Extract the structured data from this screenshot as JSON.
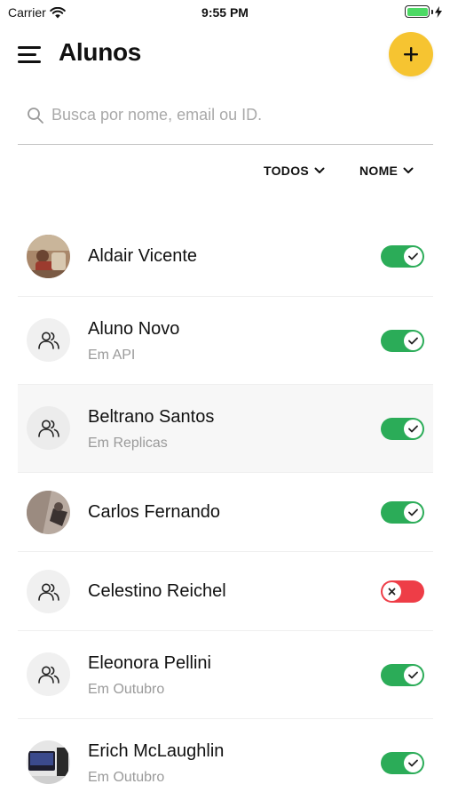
{
  "status_bar": {
    "carrier": "Carrier",
    "time": "9:55 PM",
    "wifi_icon": "wifi-icon",
    "battery_icon": "battery-icon",
    "charging_icon": "bolt-icon"
  },
  "header": {
    "title": "Alunos",
    "menu_icon": "hamburger-menu-icon",
    "add_icon": "plus-icon",
    "accent_color": "#f6c431"
  },
  "search": {
    "value": "",
    "placeholder": "Busca por nome, email ou ID.",
    "icon": "search-icon"
  },
  "filters": {
    "status": {
      "label": "TODOS",
      "icon": "chevron-down-icon"
    },
    "sort": {
      "label": "NOME",
      "icon": "chevron-down-icon"
    }
  },
  "colors": {
    "active": "#2bac58",
    "inactive": "#ee3d47",
    "subtitle": "#9a9a9a"
  },
  "students": [
    {
      "name": "Aldair Vicente",
      "subtitle": "",
      "avatar": "photo",
      "active": true,
      "highlighted": false
    },
    {
      "name": "Aluno Novo",
      "subtitle": "Em API",
      "avatar": "group-icon",
      "active": true,
      "highlighted": false
    },
    {
      "name": "Beltrano Santos",
      "subtitle": "Em Replicas",
      "avatar": "group-icon",
      "active": true,
      "highlighted": true
    },
    {
      "name": "Carlos Fernando",
      "subtitle": "",
      "avatar": "photo",
      "active": true,
      "highlighted": false
    },
    {
      "name": "Celestino Reichel",
      "subtitle": "",
      "avatar": "group-icon",
      "active": false,
      "highlighted": false
    },
    {
      "name": "Eleonora Pellini",
      "subtitle": "Em Outubro",
      "avatar": "group-icon",
      "active": true,
      "highlighted": false
    },
    {
      "name": "Erich McLaughlin",
      "subtitle": "Em Outubro",
      "avatar": "photo",
      "active": true,
      "highlighted": false
    }
  ]
}
